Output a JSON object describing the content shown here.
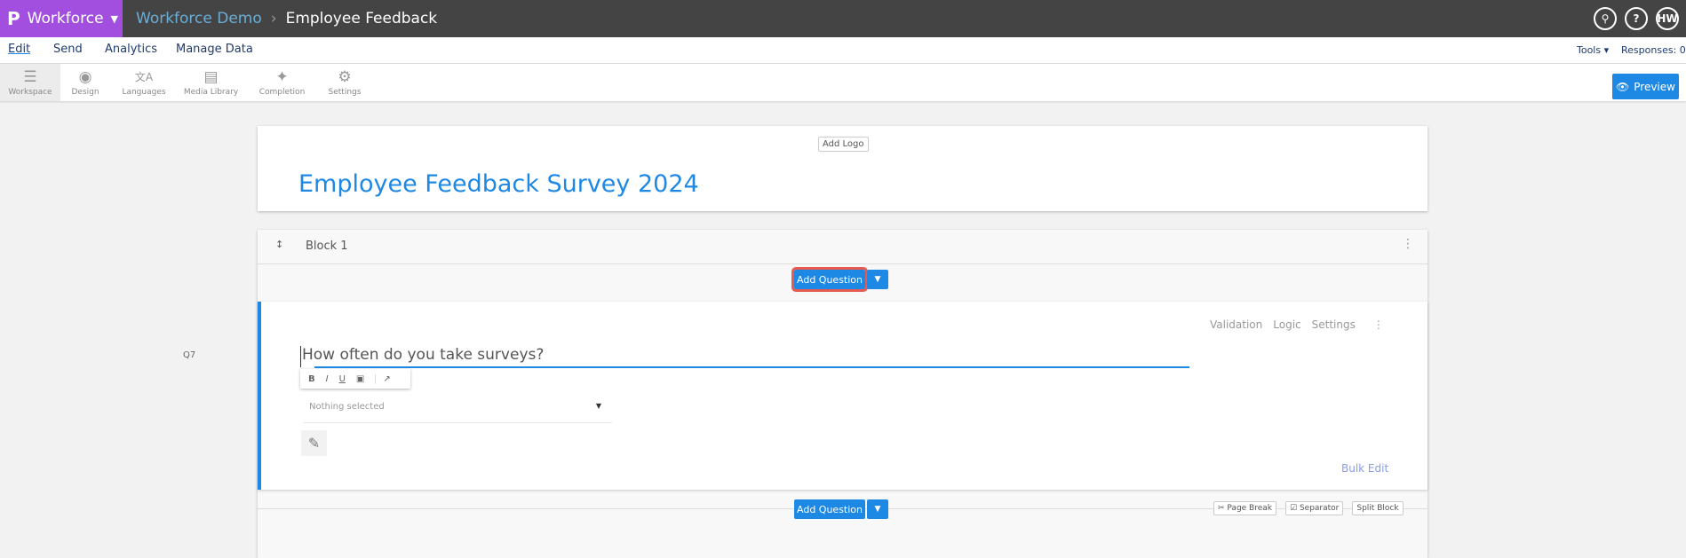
{
  "header": {
    "brand": "Workforce",
    "breadcrumb_parent": "Workforce Demo",
    "breadcrumb_sep": "›",
    "breadcrumb_current": "Employee Feedback",
    "user_initials": "HW"
  },
  "menu": {
    "items": [
      "Edit",
      "Send",
      "Analytics",
      "Manage Data"
    ],
    "tools": "Tools ▾",
    "responses": "Responses: 0"
  },
  "toolbar": {
    "items": [
      {
        "label": "Workspace",
        "icon": "workspace-icon"
      },
      {
        "label": "Design",
        "icon": "palette-icon"
      },
      {
        "label": "Languages",
        "icon": "languages-icon"
      },
      {
        "label": "Media Library",
        "icon": "image-icon"
      },
      {
        "label": "Completion",
        "icon": "magic-wand-icon"
      },
      {
        "label": "Settings",
        "icon": "gear-icon"
      }
    ],
    "preview": "Preview"
  },
  "survey": {
    "add_logo": "Add Logo",
    "title": "Employee Feedback Survey 2024"
  },
  "block": {
    "name": "Block 1",
    "add_question": "Add Question"
  },
  "question": {
    "number": "Q7",
    "text": "How often do you take surveys?",
    "links": [
      "Validation",
      "Logic",
      "Settings"
    ],
    "dropdown": "Nothing selected",
    "bulk_edit": "Bulk Edit",
    "format": [
      "B",
      "I",
      "U"
    ]
  },
  "footer": {
    "add_question": "Add Question",
    "page_break": "Page Break",
    "separator": "Separator",
    "split_block": "Split Block"
  }
}
